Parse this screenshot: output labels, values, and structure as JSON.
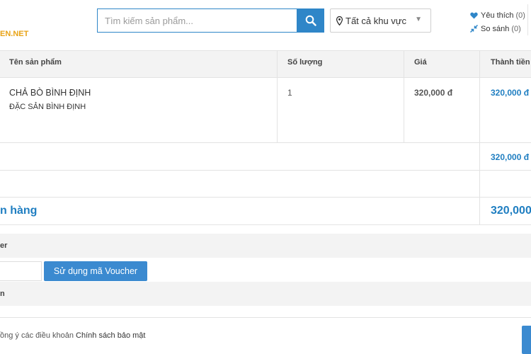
{
  "header": {
    "logo_text": "EN.NET",
    "search": {
      "placeholder": "Tìm kiếm sản phẩm...",
      "value": ""
    },
    "search_button_icon": "search-icon",
    "region": {
      "label": "Tất cả khu vực",
      "icon": "map-pin-icon"
    },
    "links": [
      {
        "label": "Yêu thích",
        "count": "(0)",
        "icon": "heart-icon"
      },
      {
        "label": "So sánh",
        "count": "(0)",
        "icon": "compare-arrows-icon"
      }
    ]
  },
  "cart": {
    "columns": [
      "Tên sản phẩm",
      "Số lượng",
      "Giá",
      "Thành tiền"
    ],
    "items": [
      {
        "name": "CHẢ BÒ BÌNH ĐỊNH",
        "subtitle": "ĐẶC SẢN BÌNH ĐỊNH",
        "quantity": "1",
        "price": "320,000 đ",
        "subtotal": "320,000 đ"
      }
    ],
    "subtotal_value": "320,000 đ",
    "total_label": "n hàng",
    "total_value": "320,000"
  },
  "voucher": {
    "section_label": "er",
    "input_value": "",
    "button_label": "Sử dụng mã Voucher"
  },
  "next_section_label": "n",
  "terms": {
    "prefix": "ồng ý các điều khoản",
    "link": "Chính sách bảo mật"
  },
  "colors": {
    "accent": "#2f86c8",
    "total_blue": "#1f7ec1",
    "logo": "#e8a317"
  }
}
